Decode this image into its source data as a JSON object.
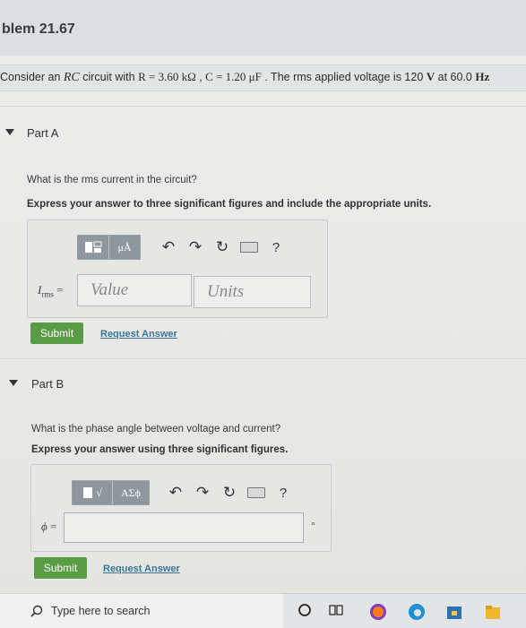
{
  "header": {
    "title": "blem 21.67"
  },
  "problem": {
    "prefix": "Consider an ",
    "rc": "RC",
    "mid1": " circuit with ",
    "r_expr": "R = 3.60 kΩ",
    "sep": " , ",
    "c_expr": "C = 1.20 μF",
    "mid2": " . The rms applied voltage is 120 ",
    "volt_unit": "V",
    "mid3": " at 60.0 ",
    "hz_unit": "Hz"
  },
  "part_a": {
    "title": "Part A",
    "question": "What is the rms current in the circuit?",
    "instruction": "Express your answer to three significant figures and include the appropriate units.",
    "toolbar": {
      "template_label": "",
      "units_label": "μÅ",
      "help_label": "?"
    },
    "variable": "I",
    "variable_sub": "rms",
    "equals": " =",
    "value_placeholder": "Value",
    "units_placeholder": "Units",
    "submit_label": "Submit",
    "request_label": "Request Answer"
  },
  "part_b": {
    "title": "Part B",
    "question": "What is the phase angle between voltage and current?",
    "instruction": "Express your answer using three significant figures.",
    "toolbar": {
      "sqrt_label": "√",
      "greek_label": "ΑΣϕ",
      "help_label": "?"
    },
    "variable": "ϕ",
    "equals": " =",
    "unit_suffix": "°",
    "submit_label": "Submit",
    "request_label": "Request Answer"
  },
  "taskbar": {
    "search_placeholder": "Type here to search"
  },
  "colors": {
    "submit": "#5a9b46",
    "link": "#3b7598",
    "toolbar": "#8e979e"
  }
}
